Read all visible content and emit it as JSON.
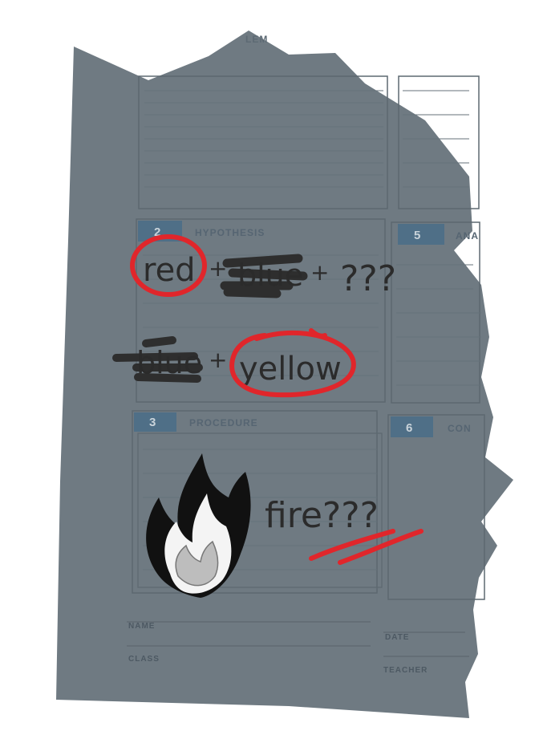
{
  "worksheet": {
    "sections": [
      {
        "number": "",
        "label": "LEM"
      },
      {
        "number": "2",
        "label": "HYPOTHESIS"
      },
      {
        "number": "5",
        "label": "ANA"
      },
      {
        "number": "3",
        "label": "PROCEDURE"
      },
      {
        "number": "6",
        "label": "CON"
      }
    ],
    "footer": {
      "name_label": "NAME",
      "class_label": "CLASS",
      "date_label": "DATE",
      "teacher_label": "TEACHER"
    }
  },
  "annotations": {
    "line1": {
      "word1": "red",
      "plus1": "+",
      "word2": "blue",
      "plus2": "+",
      "unknown": "???"
    },
    "line2": {
      "word1": "blue",
      "plus": "+",
      "word2": "yellow"
    },
    "line3": {
      "word": "fire???"
    }
  },
  "colors": {
    "paper": "#6f7a82",
    "section_header": "#4f6f87",
    "line": "#5d6870",
    "ink": "#2b2b2b",
    "marker_red": "#e0262b"
  }
}
